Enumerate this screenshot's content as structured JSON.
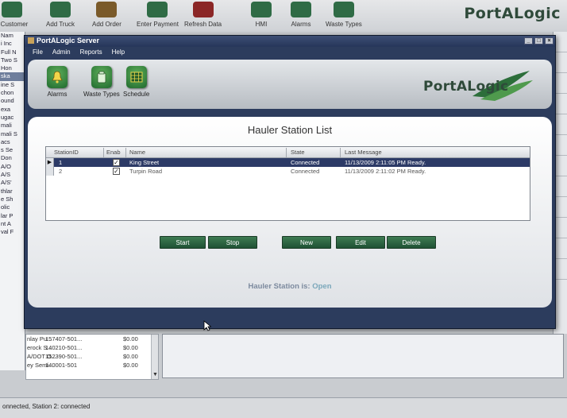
{
  "background_app": {
    "toolbar": [
      {
        "label": "d Customer"
      },
      {
        "label": "Add Truck"
      },
      {
        "label": "Add Order"
      },
      {
        "label": "Enter Payment"
      },
      {
        "label": "Refresh Data"
      },
      {
        "label": "HMI"
      },
      {
        "label": "Alarms"
      },
      {
        "label": "Waste Types"
      }
    ],
    "logo": "PortALogic",
    "left_list": [
      "Nam",
      "i Inc",
      "Full N",
      "Two S",
      "Hon",
      "ska",
      "ine S",
      "chon",
      "ound",
      "exa",
      "ugac",
      "mali",
      "mali S",
      "acs",
      "s Se",
      "Don",
      "A/O",
      "A/S",
      "A/S'",
      "thlar",
      "e Sh",
      "olic",
      "lar P",
      "nt A",
      "val F"
    ],
    "table_rows": [
      {
        "name": "nlay Pu...",
        "account": "157407-501...",
        "amount": "$0.00"
      },
      {
        "name": "erock S...",
        "account": "140210-501...",
        "amount": "$0.00"
      },
      {
        "name": "A/DOT O...",
        "account": "152390-501...",
        "amount": "$0.00"
      },
      {
        "name": "ey Semi...",
        "account": "140001-501",
        "amount": "$0.00"
      }
    ],
    "status_bar": "onnected, Station 2: connected"
  },
  "window": {
    "title": "PortALogic Server",
    "menu": [
      "File",
      "Admin",
      "Reports",
      "Help"
    ],
    "toolbar": [
      {
        "label": "Alarms",
        "icon": "bell-icon"
      },
      {
        "label": "Waste Types",
        "icon": "waste-types-icon"
      },
      {
        "label": "Schedule",
        "icon": "calendar-icon"
      }
    ],
    "logo": "PortALogic",
    "panel_title": "Hauler Station List",
    "grid": {
      "columns": [
        "StationID",
        "Enab",
        "Name",
        "State",
        "Last Message"
      ],
      "rows": [
        {
          "station_id": "1",
          "enabled": true,
          "name": "King Street",
          "state": "Connected",
          "last_message": "11/13/2009 2:11:05 PM Ready."
        },
        {
          "station_id": "2",
          "enabled": true,
          "name": "Turpin Road",
          "state": "Connected",
          "last_message": "11/13/2009 2:11:02 PM Ready."
        }
      ]
    },
    "buttons": {
      "start": "Start",
      "stop": "Stop",
      "new": "New",
      "edit": "Edit",
      "delete": "Delete"
    },
    "status": {
      "label": "Hauler Station is:",
      "value": "Open"
    }
  },
  "colors": {
    "accent_green": "#2f6b45",
    "window_frame": "#2c3c5d",
    "selected_row": "#2c3a66"
  }
}
